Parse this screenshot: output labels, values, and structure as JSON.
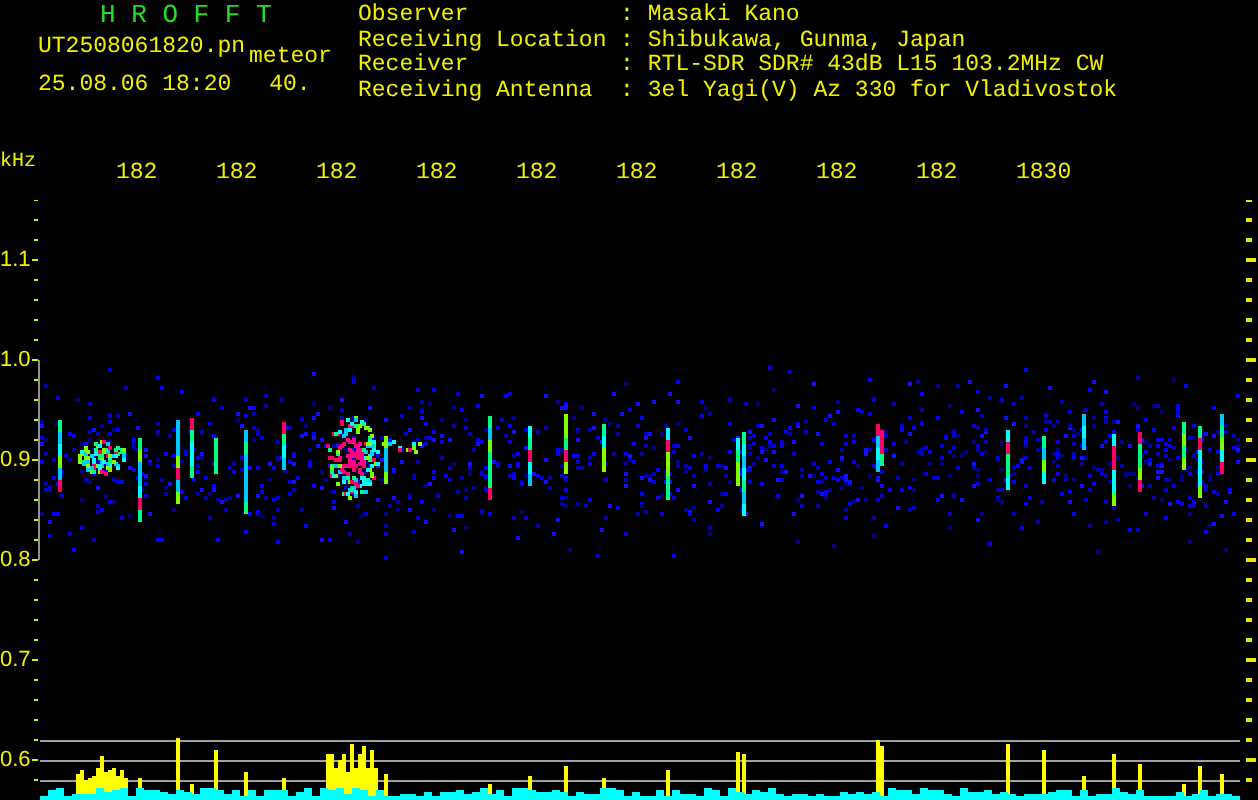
{
  "header": {
    "app_title": "H R O F F T",
    "file_name": "UT2508061820.pn",
    "event_type": "meteor",
    "timestamp": "25.08.06 18:20",
    "count": "40."
  },
  "station_info": [
    {
      "label": "Observer",
      "separator": ":",
      "value": "Masaki Kano"
    },
    {
      "label": "Receiving Location",
      "separator": ":",
      "value": "Shibukawa, Gunma, Japan"
    },
    {
      "label": "Receiver",
      "separator": ":",
      "value": "RTL-SDR SDR# 43dB L15 103.2MHz CW"
    },
    {
      "label": "Receiving Antenna",
      "separator": ":",
      "value": "3el Yagi(V) Az 330 for Vladivostok"
    }
  ],
  "frequency_axis": {
    "unit": "kHz",
    "labels": [
      "182",
      "182",
      "182",
      "182",
      "182",
      "182",
      "182",
      "182",
      "182",
      "1830"
    ]
  },
  "level_axis": {
    "labels": [
      "1.1",
      "1.0",
      "0.9",
      "0.8",
      "0.7",
      "0.6"
    ]
  }
}
